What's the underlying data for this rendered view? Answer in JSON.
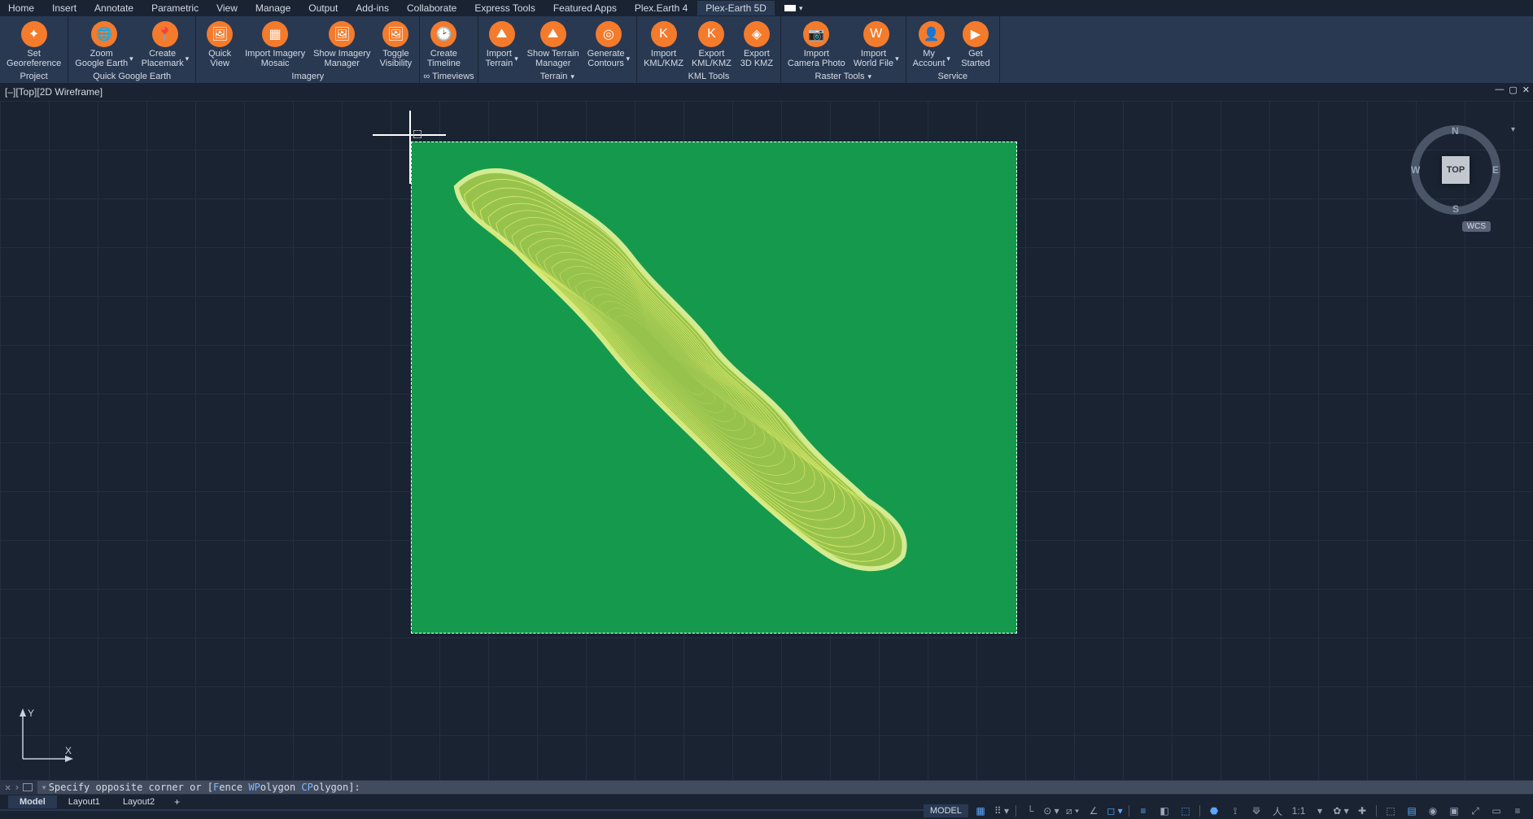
{
  "menubar": {
    "tabs": [
      "Home",
      "Insert",
      "Annotate",
      "Parametric",
      "View",
      "Manage",
      "Output",
      "Add-ins",
      "Collaborate",
      "Express Tools",
      "Featured Apps",
      "Plex.Earth 4",
      "Plex-Earth 5D"
    ],
    "active_index": 12
  },
  "ribbon": {
    "panels": [
      {
        "title": "Project",
        "has_dropdown": false,
        "buttons": [
          {
            "label": "Set\nGeoreference",
            "icon": "target-icon",
            "dropdown": false
          }
        ]
      },
      {
        "title": "Quick Google Earth",
        "has_dropdown": false,
        "buttons": [
          {
            "label": "Zoom\nGoogle Earth",
            "icon": "globe-zoom-icon",
            "dropdown": true
          },
          {
            "label": "Create\nPlacemark",
            "icon": "placemark-icon",
            "dropdown": true
          }
        ]
      },
      {
        "title": "Imagery",
        "has_dropdown": false,
        "buttons": [
          {
            "label": "Quick\nView",
            "icon": "image-pin-icon",
            "dropdown": false
          },
          {
            "label": "Import Imagery\nMosaic",
            "icon": "grid-plus-icon",
            "dropdown": false
          },
          {
            "label": "Show Imagery\nManager",
            "icon": "image-gear-icon",
            "dropdown": false
          },
          {
            "label": "Toggle\nVisibility",
            "icon": "image-eye-icon",
            "dropdown": false
          }
        ]
      },
      {
        "title": "∞ Timeviews",
        "has_dropdown": false,
        "buttons": [
          {
            "label": "Create\nTimeline",
            "icon": "timeline-icon",
            "dropdown": false
          }
        ]
      },
      {
        "title": "Terrain",
        "has_dropdown": true,
        "buttons": [
          {
            "label": "Import\nTerrain",
            "icon": "terrain-import-icon",
            "dropdown": true
          },
          {
            "label": "Show Terrain\nManager",
            "icon": "terrain-manager-icon",
            "dropdown": false
          },
          {
            "label": "Generate\nContours",
            "icon": "contours-icon",
            "dropdown": true
          }
        ]
      },
      {
        "title": "KML Tools",
        "has_dropdown": false,
        "buttons": [
          {
            "label": "Import\nKML/KMZ",
            "icon": "kml-import-icon",
            "dropdown": false
          },
          {
            "label": "Export\nKML/KMZ",
            "icon": "kml-export-icon",
            "dropdown": false
          },
          {
            "label": "Export\n3D KMZ",
            "icon": "kml-3d-icon",
            "dropdown": false
          }
        ]
      },
      {
        "title": "Raster Tools",
        "has_dropdown": true,
        "buttons": [
          {
            "label": "Import\nCamera Photo",
            "icon": "camera-icon",
            "dropdown": false
          },
          {
            "label": "Import\nWorld File",
            "icon": "world-file-icon",
            "dropdown": true
          }
        ]
      },
      {
        "title": "Service",
        "has_dropdown": false,
        "buttons": [
          {
            "label": "My\nAccount",
            "icon": "user-icon",
            "dropdown": true
          },
          {
            "label": "Get\nStarted",
            "icon": "play-icon",
            "dropdown": false
          }
        ]
      }
    ]
  },
  "viewport": {
    "label": "[–][Top][2D Wireframe]",
    "viewcube": {
      "face": "TOP",
      "n": "N",
      "s": "S",
      "e": "E",
      "w": "W"
    },
    "wcs": "WCS",
    "ucs": {
      "y": "Y",
      "x": "X"
    }
  },
  "commandbar": {
    "prefix": "Specify opposite corner or [",
    "opt1_hi": "F",
    "opt1_rest": "ence",
    "opt2_hi": "WP",
    "opt2_rest": "olygon",
    "opt3_hi": "CP",
    "opt3_rest": "olygon",
    "suffix": "]:"
  },
  "tabbar": {
    "tabs": [
      "Model",
      "Layout1",
      "Layout2"
    ],
    "active_index": 0,
    "plus": "+"
  },
  "statusbar": {
    "model": "MODEL",
    "ratio": "1:1"
  }
}
